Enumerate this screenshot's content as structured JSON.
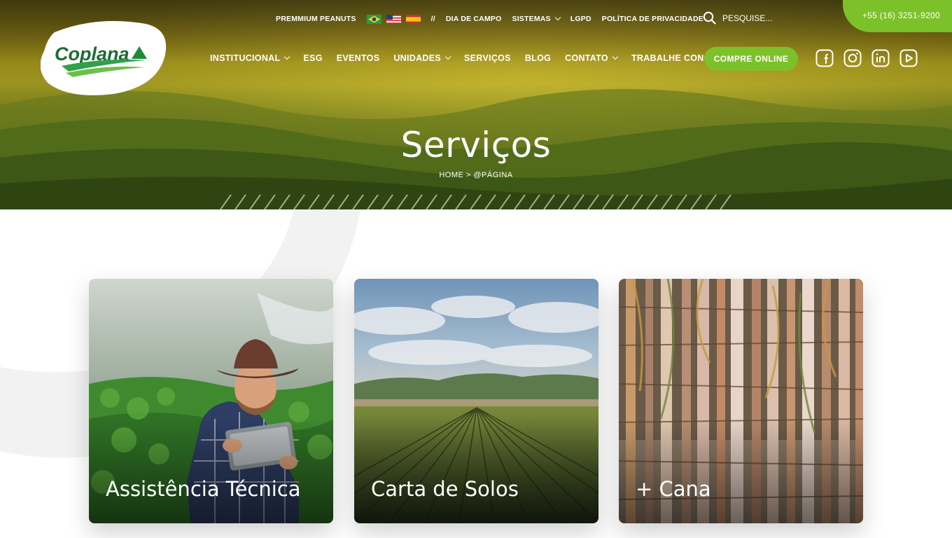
{
  "topbar": {
    "peanuts": "PREMMIUM PEANUTS",
    "flags": [
      "flag-brazil-icon",
      "flag-usa-icon",
      "flag-spain-icon"
    ],
    "separator": "//",
    "dia_campo": "DIA DE CAMPO",
    "sistemas": "SISTEMAS",
    "lgpd": "LGPD",
    "privacidade": "POLÍTICA DE PRIVACIDADE"
  },
  "search": {
    "placeholder": "PESQUISE...",
    "icon": "search-icon"
  },
  "phone": "+55 (16) 3251-9200",
  "logo": {
    "text": "Coplana"
  },
  "nav": {
    "institucional": "INSTITUCIONAL",
    "esg": "ESG",
    "eventos": "EVENTOS",
    "unidades": "UNIDADES",
    "servicos": "SERVIÇOS",
    "blog": "BLOG",
    "contato": "CONTATO",
    "trabalhe": "TRABALHE CONOSCO",
    "compre": "COMPRE ONLINE"
  },
  "social": [
    "facebook-icon",
    "instagram-icon",
    "linkedin-icon",
    "youtube-icon"
  ],
  "hero": {
    "title": "Serviços",
    "breadcrumb": "HOME > @PÁGINA"
  },
  "cards": [
    {
      "title": "Assistência Técnica"
    },
    {
      "title": "Carta de Solos"
    },
    {
      "title": "+ Cana"
    }
  ],
  "colors": {
    "brand_green": "#7dc12a",
    "logo_green": "#1d8a3a"
  }
}
